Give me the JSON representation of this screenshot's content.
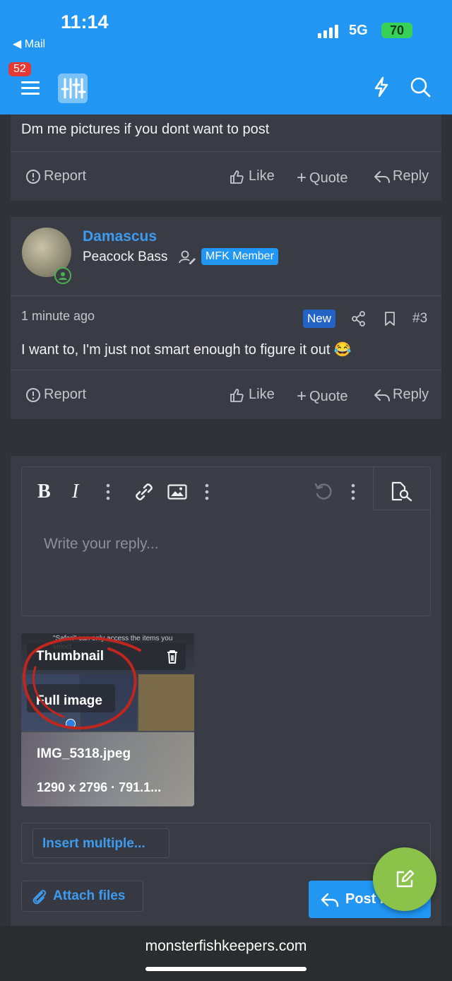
{
  "status": {
    "time": "11:14",
    "back_label": "Mail",
    "network": "5G",
    "battery": "70"
  },
  "header": {
    "notif_count": "52"
  },
  "post1": {
    "text": "Dm me pictures if you dont want to post"
  },
  "actions": {
    "report": "Report",
    "like": "Like",
    "quote": "Quote",
    "reply": "Reply"
  },
  "post2": {
    "username": "Damascus",
    "title": "Peacock Bass",
    "member_badge": "MFK Member",
    "time": "1 minute ago",
    "new_badge": "New",
    "number": "#3",
    "text": "I want to, I'm just not smart enough to figure it out 😂"
  },
  "editor": {
    "placeholder": "Write your reply..."
  },
  "attachment": {
    "overlay_text": "\"Safari\" can only access the items you select.",
    "thumbnail_label": "Thumbnail",
    "full_image_label": "Full image",
    "filename": "IMG_5318.jpeg",
    "meta": "1290 x 2796 · 791.1..."
  },
  "buttons": {
    "insert_multiple": "Insert multiple...",
    "attach_files": "Attach files",
    "post_reply": "Post r"
  },
  "footer": {
    "domain": "monsterfishkeepers.com"
  },
  "colors": {
    "header_blue": "#2196f3",
    "accent_blue": "#3d9bf0",
    "fab_green": "#8bc34a"
  }
}
